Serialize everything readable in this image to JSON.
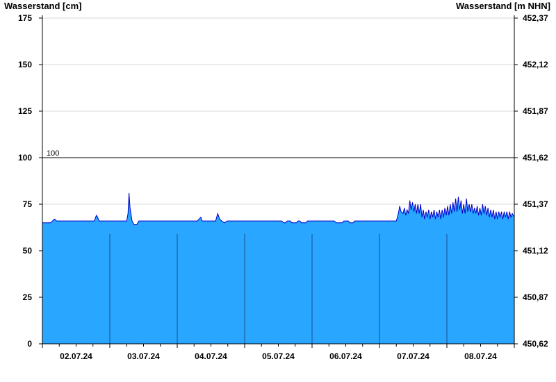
{
  "chart_data": {
    "type": "area",
    "left_axis_label": "Wasserstand [cm]",
    "right_axis_label": "Wasserstand [m NHN]",
    "ylim": [
      0,
      175
    ],
    "yticks": [
      {
        "value": 0,
        "label": "0"
      },
      {
        "value": 25,
        "label": "25"
      },
      {
        "value": 50,
        "label": "50"
      },
      {
        "value": 75,
        "label": "75"
      },
      {
        "value": 100,
        "label": "100"
      },
      {
        "value": 125,
        "label": "125"
      },
      {
        "value": 150,
        "label": "150"
      },
      {
        "value": 175,
        "label": "175"
      }
    ],
    "right_ticks": [
      {
        "value": 0,
        "label": "450,62"
      },
      {
        "value": 25,
        "label": "450,87"
      },
      {
        "value": 50,
        "label": "451,12"
      },
      {
        "value": 75,
        "label": "451,37"
      },
      {
        "value": 100,
        "label": "451,62"
      },
      {
        "value": 125,
        "label": "451,87"
      },
      {
        "value": 150,
        "label": "452,12"
      },
      {
        "value": 175,
        "label": "452,37"
      }
    ],
    "x_range_days": [
      1.5,
      8.5
    ],
    "day_labels": [
      {
        "day": 2,
        "label": "02.07.24"
      },
      {
        "day": 3,
        "label": "03.07.24"
      },
      {
        "day": 4,
        "label": "04.07.24"
      },
      {
        "day": 5,
        "label": "05.07.24"
      },
      {
        "day": 6,
        "label": "06.07.24"
      },
      {
        "day": 7,
        "label": "07.07.24"
      },
      {
        "day": 8,
        "label": "08.07.24"
      }
    ],
    "reference_line": {
      "value": 100,
      "label": "100"
    },
    "fill_color": "#29a6ff",
    "line_color": "#0000cc",
    "grid": true,
    "series": [
      {
        "points": [
          [
            1.5,
            65
          ],
          [
            1.62,
            65
          ],
          [
            1.65,
            66
          ],
          [
            1.68,
            67
          ],
          [
            1.71,
            66
          ],
          [
            1.9,
            66
          ],
          [
            2.27,
            66
          ],
          [
            2.29,
            68
          ],
          [
            2.3,
            69
          ],
          [
            2.32,
            68
          ],
          [
            2.34,
            66
          ],
          [
            2.75,
            66
          ],
          [
            2.77,
            70
          ],
          [
            2.785,
            81
          ],
          [
            2.8,
            73
          ],
          [
            2.83,
            66
          ],
          [
            2.86,
            64
          ],
          [
            2.9,
            64
          ],
          [
            2.93,
            66
          ],
          [
            3.8,
            66
          ],
          [
            3.85,
            68
          ],
          [
            3.87,
            66
          ],
          [
            4.07,
            66
          ],
          [
            4.1,
            70
          ],
          [
            4.13,
            67
          ],
          [
            4.16,
            66
          ],
          [
            4.2,
            65
          ],
          [
            4.24,
            66
          ],
          [
            5.05,
            66
          ],
          [
            5.08,
            65
          ],
          [
            5.11,
            65
          ],
          [
            5.13,
            66
          ],
          [
            5.18,
            66
          ],
          [
            5.2,
            65
          ],
          [
            5.27,
            65
          ],
          [
            5.29,
            66
          ],
          [
            5.32,
            66
          ],
          [
            5.34,
            65
          ],
          [
            5.41,
            65
          ],
          [
            5.43,
            66
          ],
          [
            5.83,
            66
          ],
          [
            5.86,
            65
          ],
          [
            5.95,
            65
          ],
          [
            5.97,
            66
          ],
          [
            6.04,
            66
          ],
          [
            6.06,
            65
          ],
          [
            6.11,
            65
          ],
          [
            6.13,
            66
          ],
          [
            6.75,
            66
          ],
          [
            6.78,
            70
          ],
          [
            6.8,
            74
          ],
          [
            6.82,
            71
          ],
          [
            6.85,
            70
          ],
          [
            6.87,
            73
          ],
          [
            6.89,
            69
          ],
          [
            6.91,
            72
          ],
          [
            6.93,
            70
          ],
          [
            6.95,
            77
          ],
          [
            6.97,
            72
          ],
          [
            6.99,
            76
          ],
          [
            7.01,
            71
          ],
          [
            7.03,
            75
          ],
          [
            7.05,
            70
          ],
          [
            7.07,
            75
          ],
          [
            7.09,
            70
          ],
          [
            7.11,
            75
          ],
          [
            7.13,
            68
          ],
          [
            7.15,
            72
          ],
          [
            7.17,
            67
          ],
          [
            7.19,
            71
          ],
          [
            7.21,
            68
          ],
          [
            7.23,
            72
          ],
          [
            7.25,
            67
          ],
          [
            7.27,
            71
          ],
          [
            7.29,
            68
          ],
          [
            7.31,
            72
          ],
          [
            7.33,
            67
          ],
          [
            7.35,
            71
          ],
          [
            7.37,
            68
          ],
          [
            7.39,
            72
          ],
          [
            7.41,
            67
          ],
          [
            7.43,
            72
          ],
          [
            7.45,
            68
          ],
          [
            7.47,
            73
          ],
          [
            7.49,
            69
          ],
          [
            7.51,
            74
          ],
          [
            7.53,
            69
          ],
          [
            7.55,
            75
          ],
          [
            7.57,
            70
          ],
          [
            7.59,
            76
          ],
          [
            7.61,
            71
          ],
          [
            7.63,
            78
          ],
          [
            7.65,
            71
          ],
          [
            7.67,
            79
          ],
          [
            7.69,
            72
          ],
          [
            7.71,
            77
          ],
          [
            7.73,
            70
          ],
          [
            7.75,
            75
          ],
          [
            7.77,
            70
          ],
          [
            7.79,
            78
          ],
          [
            7.81,
            71
          ],
          [
            7.83,
            75
          ],
          [
            7.85,
            71
          ],
          [
            7.87,
            75
          ],
          [
            7.89,
            70
          ],
          [
            7.91,
            73
          ],
          [
            7.93,
            70
          ],
          [
            7.95,
            74
          ],
          [
            7.97,
            69
          ],
          [
            7.99,
            73
          ],
          [
            8.01,
            69
          ],
          [
            8.03,
            75
          ],
          [
            8.05,
            70
          ],
          [
            8.07,
            74
          ],
          [
            8.09,
            69
          ],
          [
            8.11,
            73
          ],
          [
            8.13,
            68
          ],
          [
            8.15,
            72
          ],
          [
            8.17,
            68
          ],
          [
            8.19,
            72
          ],
          [
            8.21,
            67
          ],
          [
            8.23,
            71
          ],
          [
            8.25,
            67
          ],
          [
            8.27,
            71
          ],
          [
            8.29,
            68
          ],
          [
            8.31,
            71
          ],
          [
            8.33,
            67
          ],
          [
            8.35,
            71
          ],
          [
            8.37,
            68
          ],
          [
            8.39,
            71
          ],
          [
            8.41,
            67
          ],
          [
            8.43,
            71
          ],
          [
            8.45,
            68
          ],
          [
            8.47,
            70
          ],
          [
            8.5,
            68
          ]
        ]
      }
    ]
  }
}
